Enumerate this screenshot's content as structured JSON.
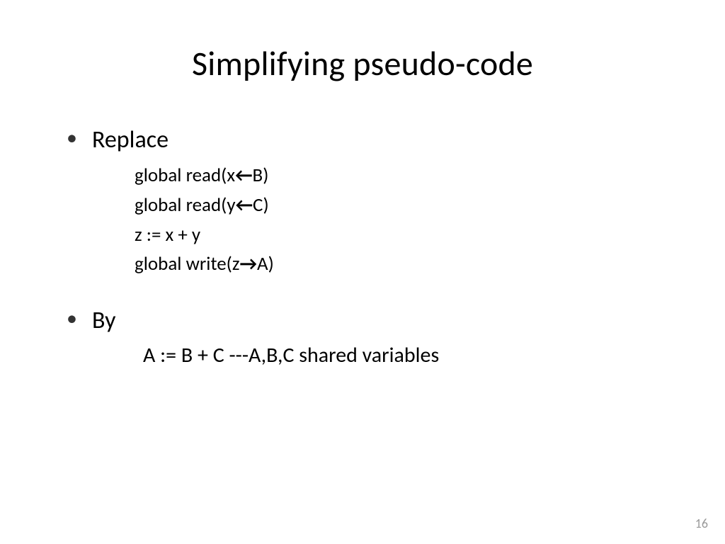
{
  "slide": {
    "title": "Simplifying pseudo-code",
    "bullet1_label": "Replace",
    "code": {
      "l1_pre": "global read(x",
      "l1_arrow": "←",
      "l1_post": "B)",
      "l2_pre": "global read(y",
      "l2_arrow": "←",
      "l2_post": "C)",
      "l3": "z := x + y",
      "l4_pre": "global write(z",
      "l4_arrow": "→",
      "l4_post": "A)"
    },
    "bullet2_label": "By",
    "result_line": "A := B + C     ---A,B,C shared variables",
    "page_number": "16"
  }
}
